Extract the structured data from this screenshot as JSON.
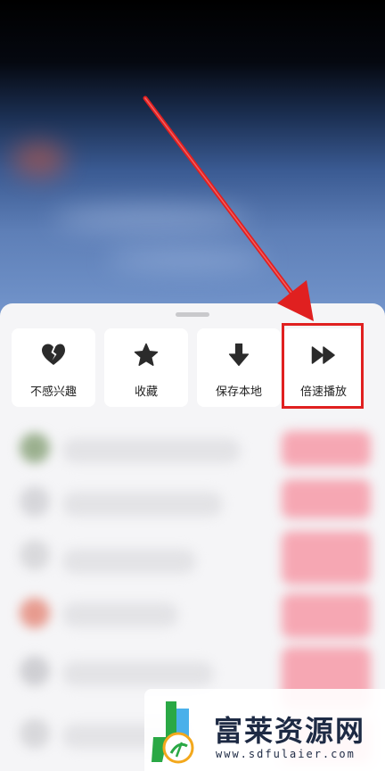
{
  "sheet": {
    "actions": [
      {
        "id": "not-interested",
        "label": "不感兴趣",
        "icon": "broken-heart-icon"
      },
      {
        "id": "favorite",
        "label": "收藏",
        "icon": "star-icon"
      },
      {
        "id": "save-local",
        "label": "保存本地",
        "icon": "download-arrow-icon"
      },
      {
        "id": "playback-speed",
        "label": "倍速播放",
        "icon": "fast-forward-icon"
      }
    ]
  },
  "annotation": {
    "highlight_color": "#e02020"
  },
  "watermark": {
    "title": "富莱资源网",
    "url": "www.sdfulaier.com"
  }
}
